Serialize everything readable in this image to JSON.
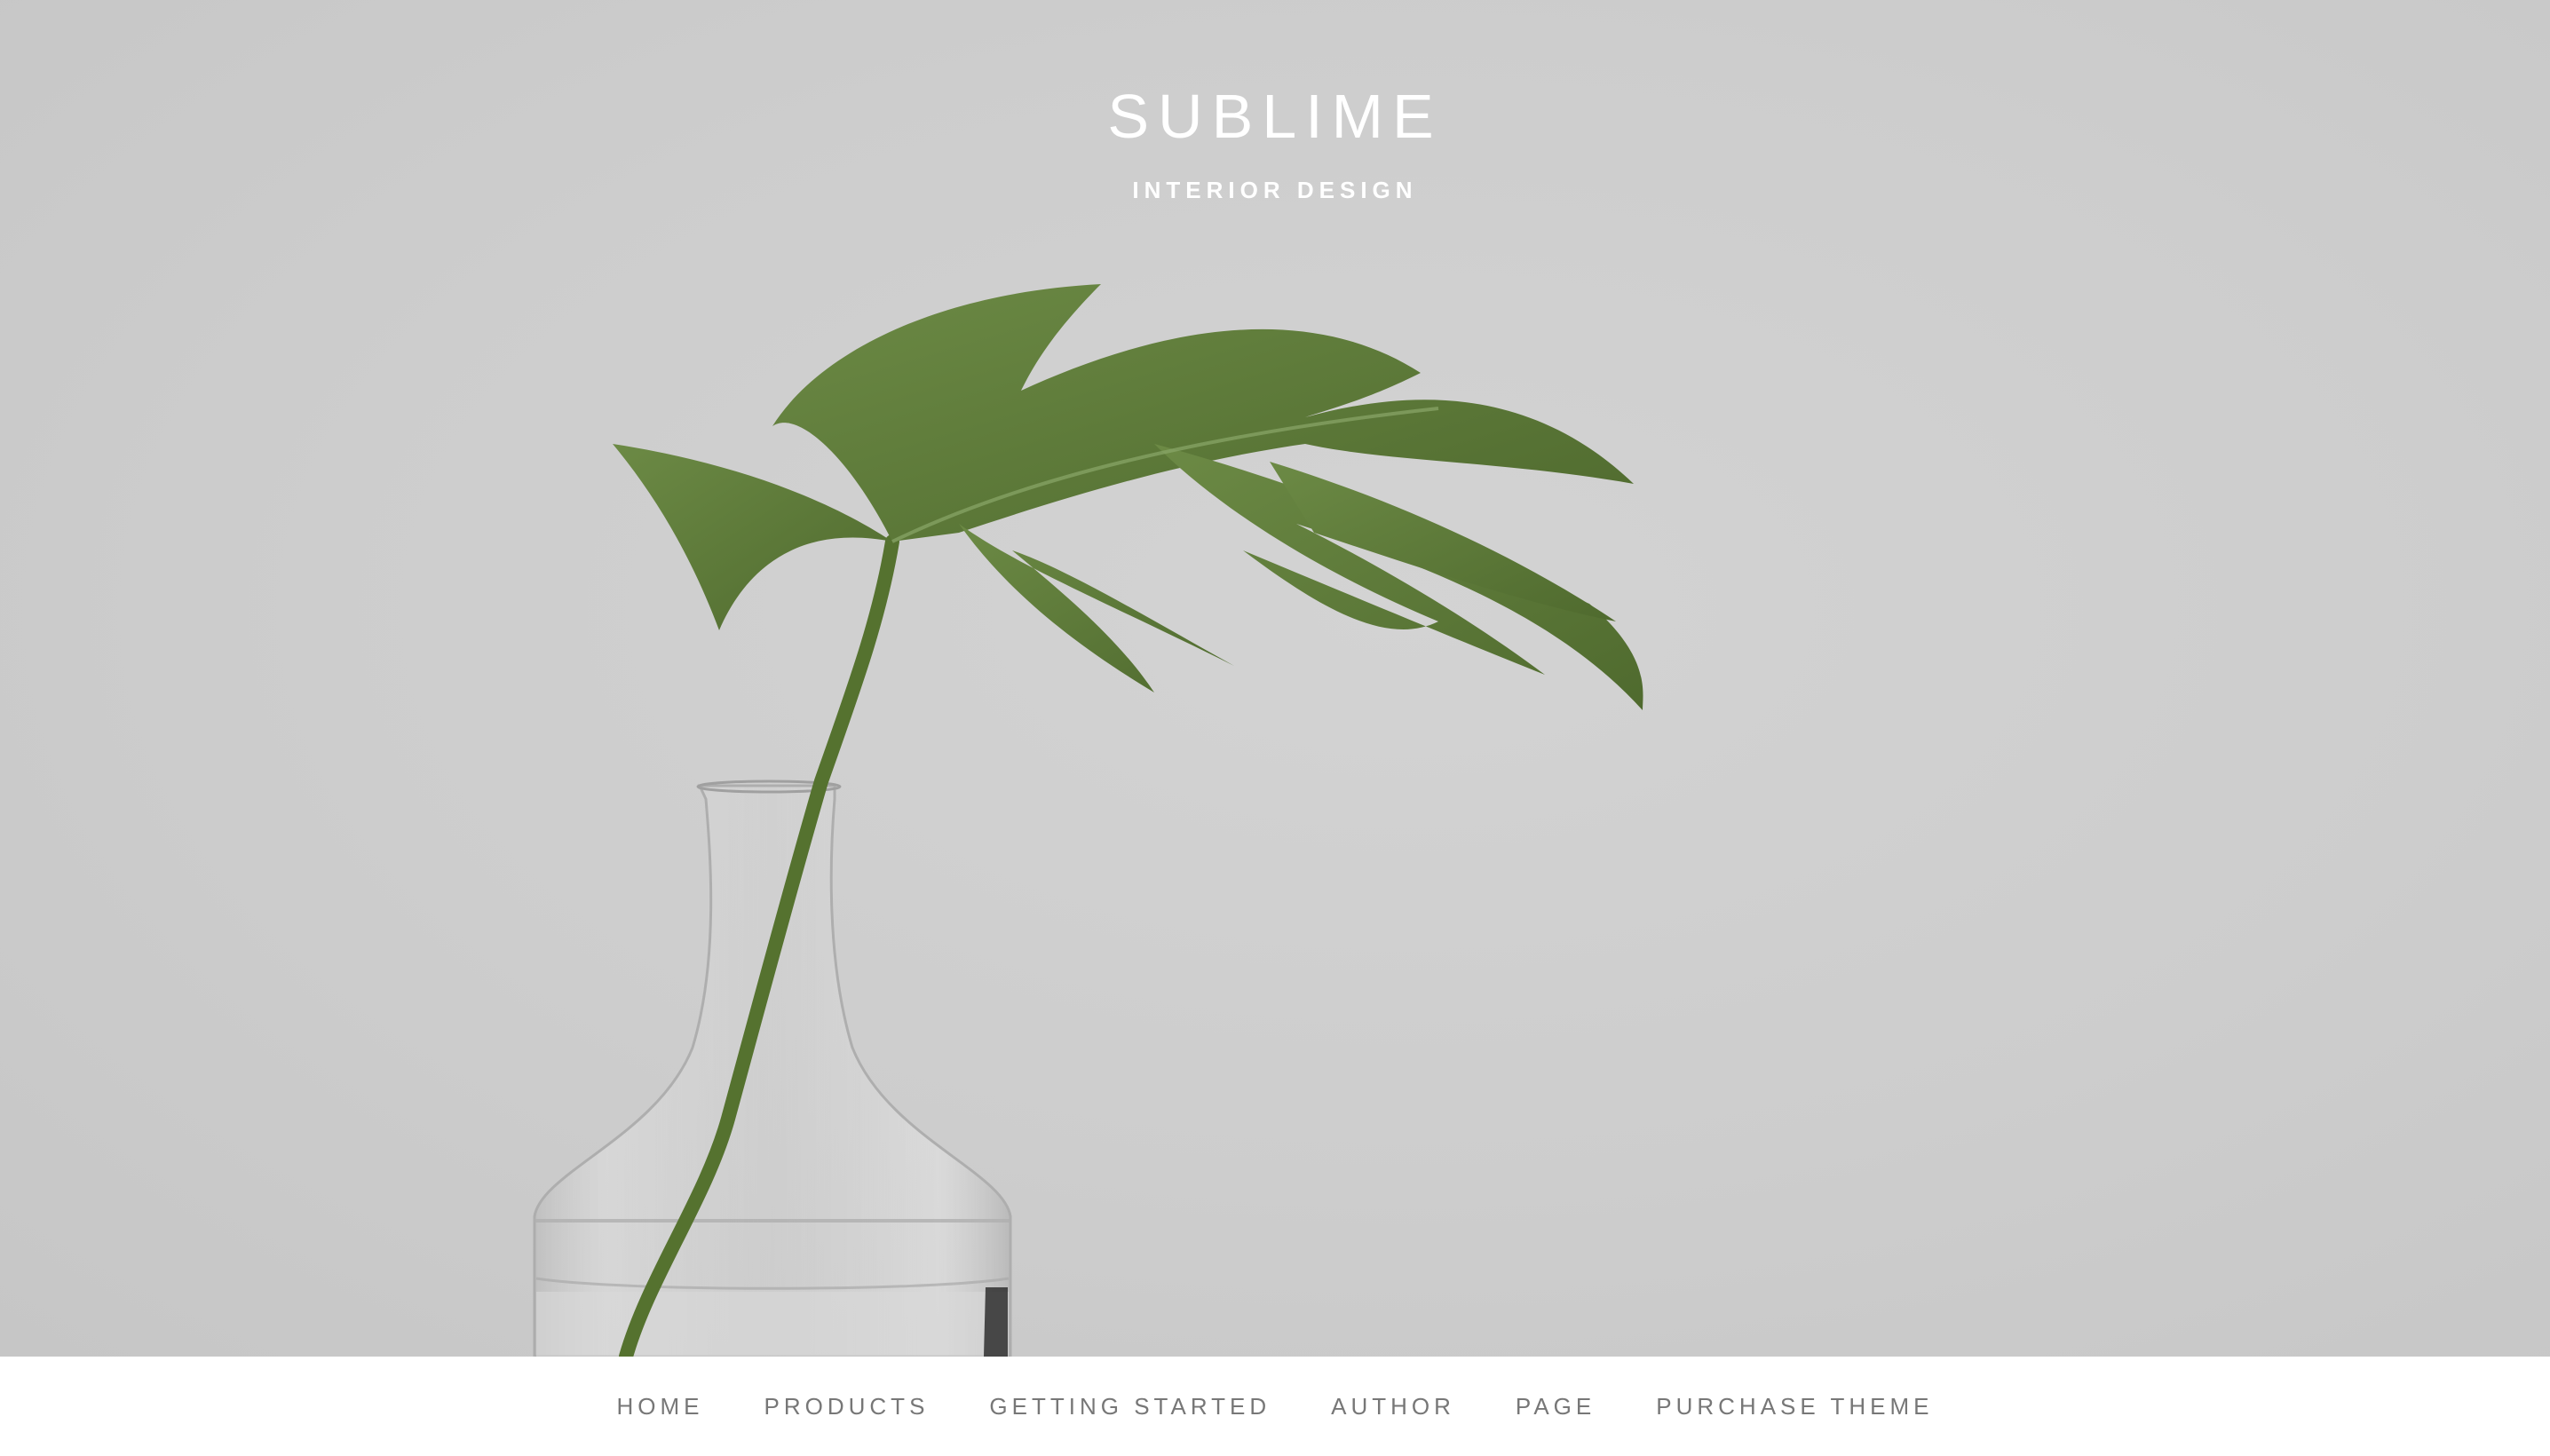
{
  "site": {
    "title": "SUBLIME",
    "tagline": "INTERIOR DESIGN"
  },
  "hero": {
    "image": "monstera-leaf-in-glass-vase",
    "background_color": "#cccccc",
    "leaf_color": "#5f7a3c"
  },
  "nav": {
    "items": [
      {
        "label": "HOME"
      },
      {
        "label": "PRODUCTS"
      },
      {
        "label": "GETTING STARTED"
      },
      {
        "label": "AUTHOR"
      },
      {
        "label": "PAGE"
      },
      {
        "label": "PURCHASE THEME"
      }
    ],
    "text_color": "#777777"
  }
}
